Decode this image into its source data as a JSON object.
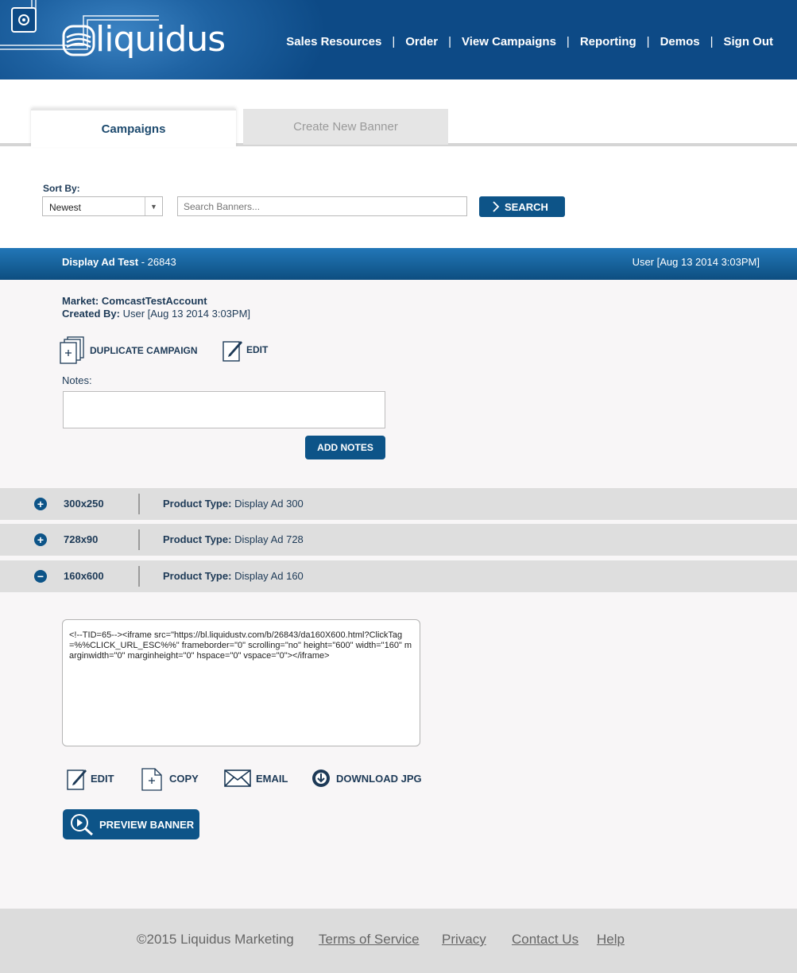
{
  "header": {
    "logo": "liquidus",
    "nav": [
      "Sales Resources",
      "Order",
      "View Campaigns",
      "Reporting",
      "Demos",
      "Sign Out"
    ],
    "separator": "|"
  },
  "tabs": {
    "active": "Campaigns",
    "inactive": "Create New Banner"
  },
  "filters": {
    "sort_label": "Sort By:",
    "sort_value": "Newest",
    "search_placeholder": "Search Banners...",
    "search_button": "SEARCH"
  },
  "campaign": {
    "name": "Display Ad Test",
    "id": " - 26843",
    "created": "User [Aug 13 2014 3:03PM]",
    "market_label": "Market:",
    "market_value": "ComcastTestAccount",
    "created_by_label": "Created By:",
    "created_by_value": "User [Aug 13 2014 3:03PM]",
    "duplicate_label": "DUPLICATE CAMPAIGN",
    "edit_label": "EDIT",
    "notes_label": "Notes:",
    "add_notes_label": "ADD NOTES"
  },
  "banners": [
    {
      "toggle": "+",
      "size": "300x250",
      "ptype_label": "Product Type:",
      "ptype_value": "Display Ad 300"
    },
    {
      "toggle": "+",
      "size": "728x90",
      "ptype_label": "Product Type:",
      "ptype_value": "Display Ad 728"
    },
    {
      "toggle": "−",
      "size": "160x600",
      "ptype_label": "Product Type:",
      "ptype_value": "Display Ad 160"
    }
  ],
  "embed_code": "<!--TID=65--><iframe src=\"https://bl.liquidustv.com/b/26843/da160X600.html?ClickTag=%%CLICK_URL_ESC%%\" frameborder=\"0\" scrolling=\"no\" height=\"600\" width=\"160\" marginwidth=\"0\" marginheight=\"0\" hspace=\"0\" vspace=\"0\"></iframe>",
  "banner_actions": {
    "edit": "EDIT",
    "copy": "COPY",
    "email": "EMAIL",
    "download": "DOWNLOAD JPG",
    "preview": "PREVIEW BANNER"
  },
  "footer": {
    "copyright": "©2015 Liquidus Marketing",
    "links": [
      "Terms of Service",
      "Privacy",
      "Contact Us",
      "Help"
    ]
  },
  "colors": {
    "brand_blue": "#0d5488",
    "header_blue": "#1f63a3",
    "text_navy": "#1d3a57",
    "row_gray": "#dedede"
  },
  "icons": [
    "settings-box-icon",
    "duplicate-icon",
    "edit-icon",
    "copy-icon",
    "email-icon",
    "download-icon",
    "preview-magnifier-icon",
    "chevron-right-icon",
    "expand-icon",
    "collapse-icon"
  ]
}
